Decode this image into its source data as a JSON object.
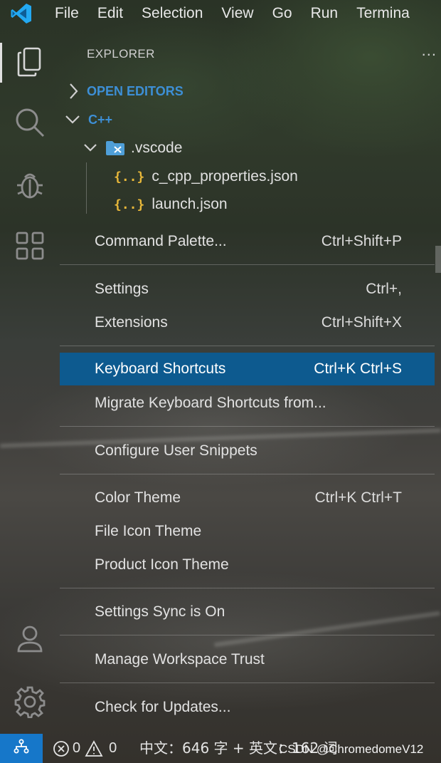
{
  "menubar": {
    "items": [
      "File",
      "Edit",
      "Selection",
      "View",
      "Go",
      "Run",
      "Termina"
    ]
  },
  "activitybar": {
    "icons": [
      "files-icon",
      "search-icon",
      "debug-icon",
      "extensions-icon",
      "account-icon",
      "gear-icon"
    ]
  },
  "explorer": {
    "title": "EXPLORER",
    "more": "...",
    "open_editors": "OPEN EDITORS",
    "workspace": "C++",
    "folder": ".vscode",
    "files": [
      "c_cpp_properties.json",
      "launch.json"
    ],
    "json_icon": "{..}"
  },
  "menu": {
    "items": [
      {
        "label": "Command Palette...",
        "shortcut": "Ctrl+Shift+P"
      },
      {
        "label": "Settings",
        "shortcut": "Ctrl+,"
      },
      {
        "label": "Extensions",
        "shortcut": "Ctrl+Shift+X"
      },
      {
        "label": "Keyboard Shortcuts",
        "shortcut": "Ctrl+K Ctrl+S"
      },
      {
        "label": "Migrate Keyboard Shortcuts from...",
        "shortcut": ""
      },
      {
        "label": "Configure User Snippets",
        "shortcut": ""
      },
      {
        "label": "Color Theme",
        "shortcut": "Ctrl+K Ctrl+T"
      },
      {
        "label": "File Icon Theme",
        "shortcut": ""
      },
      {
        "label": "Product Icon Theme",
        "shortcut": ""
      },
      {
        "label": "Settings Sync is On",
        "shortcut": ""
      },
      {
        "label": "Manage Workspace Trust",
        "shortcut": ""
      },
      {
        "label": "Check for Updates...",
        "shortcut": ""
      }
    ]
  },
  "statusbar": {
    "errors": "0",
    "warnings": "0",
    "wordcount": "中文：646 字 + 英文：162 词"
  },
  "watermark": "CSDN @ChromedomeV12",
  "colors": {
    "accent": "#1677c9",
    "selected": "#0d5a8f",
    "section_label": "#3d8fd6",
    "json_icon": "#e8b83a"
  }
}
